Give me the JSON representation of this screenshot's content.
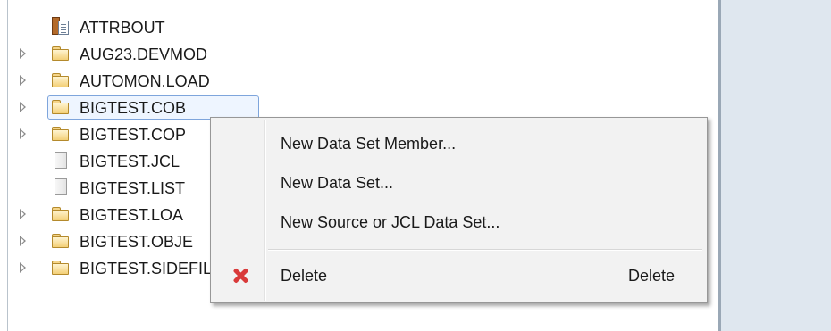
{
  "tree": {
    "items": [
      {
        "label": "ATTRBOUT",
        "icon": "library-icon",
        "expandable": false
      },
      {
        "label": "AUG23.DEVMOD",
        "icon": "folder-icon",
        "expandable": true
      },
      {
        "label": "AUTOMON.LOAD",
        "icon": "folder-icon",
        "expandable": true
      },
      {
        "label": "BIGTEST.COB",
        "icon": "folder-icon",
        "expandable": true,
        "selected": true
      },
      {
        "label": "BIGTEST.COP",
        "icon": "folder-icon",
        "expandable": true
      },
      {
        "label": "BIGTEST.JCL",
        "icon": "file-icon",
        "expandable": false
      },
      {
        "label": "BIGTEST.LIST",
        "icon": "file-icon",
        "expandable": false
      },
      {
        "label": "BIGTEST.LOA",
        "icon": "folder-icon",
        "expandable": true
      },
      {
        "label": "BIGTEST.OBJE",
        "icon": "folder-icon",
        "expandable": true
      },
      {
        "label": "BIGTEST.SIDEFILE",
        "icon": "folder-icon",
        "expandable": true
      }
    ]
  },
  "context_menu": {
    "items": [
      {
        "label": "New Data Set Member..."
      },
      {
        "label": "New Data Set..."
      },
      {
        "label": "New Source or JCL Data Set..."
      },
      {
        "label": "Delete",
        "shortcut": "Delete",
        "icon": "delete-icon"
      }
    ]
  },
  "colors": {
    "selection_border": "#7ea5dc",
    "menu_background": "#f2f2f2",
    "delete_icon": "#d93a3a",
    "right_panel": "#dfe7ef"
  }
}
